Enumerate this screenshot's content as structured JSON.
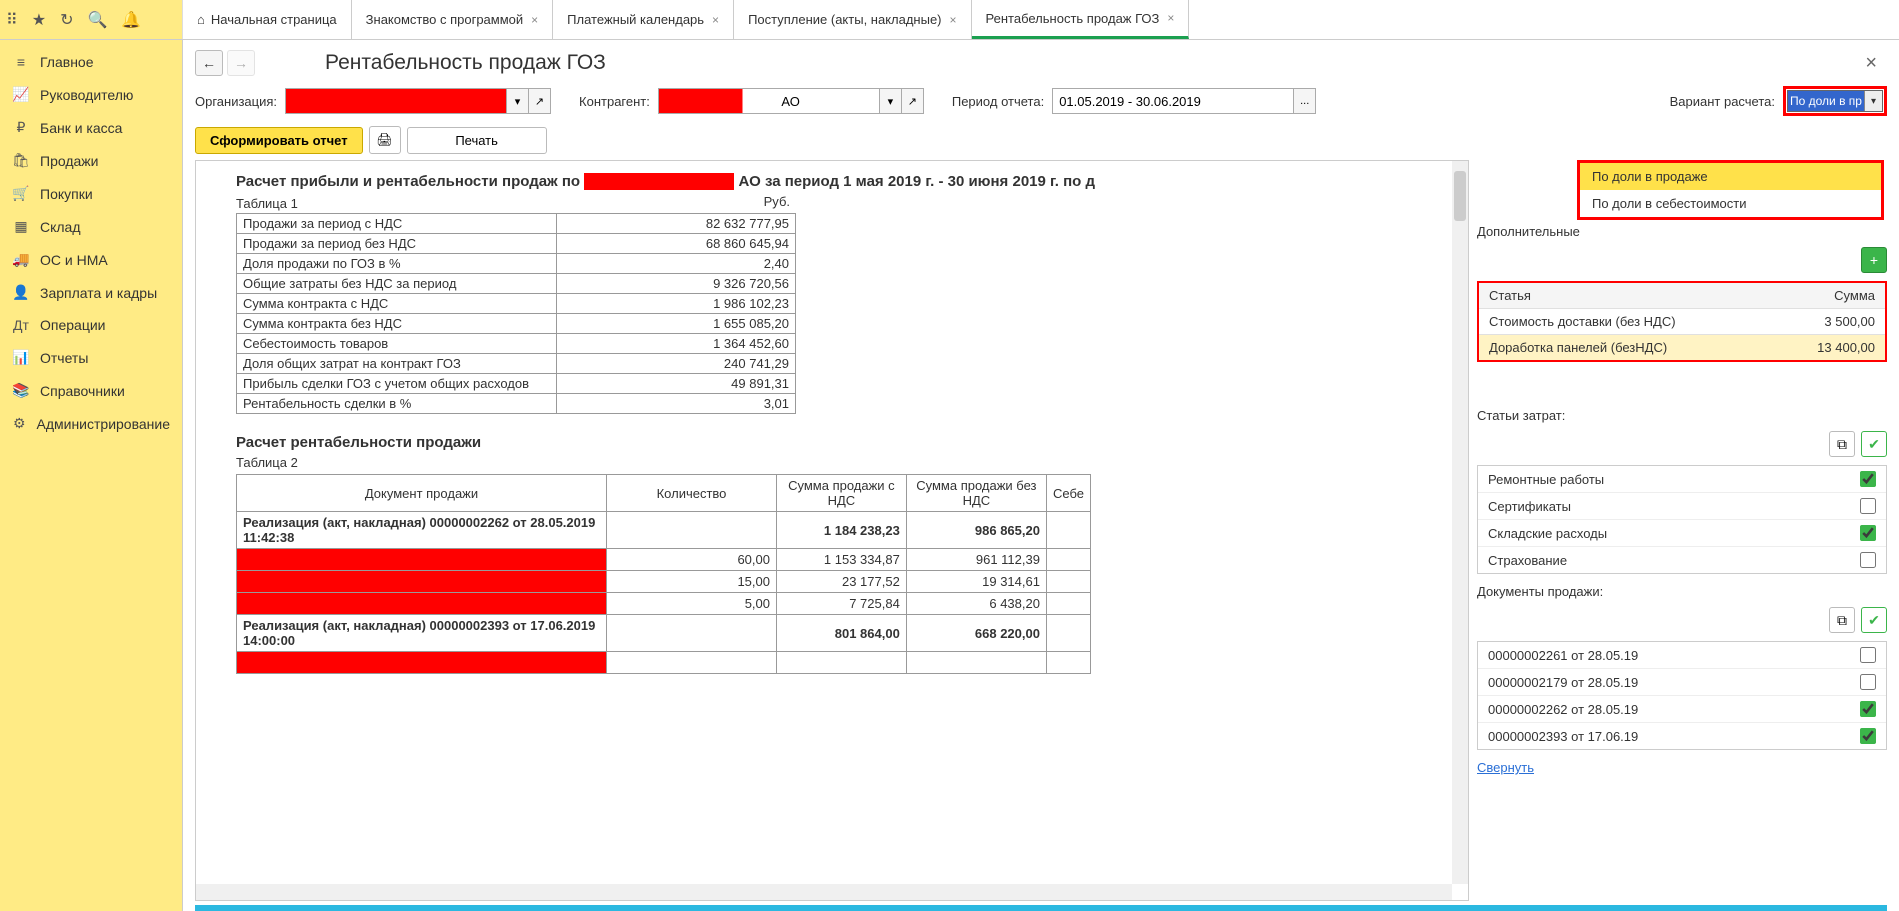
{
  "toolbar_icons": [
    "grid",
    "star",
    "history",
    "search",
    "bell"
  ],
  "tabs": [
    {
      "label": "Начальная страница",
      "home": true,
      "close": false
    },
    {
      "label": "Знакомство с программой",
      "close": true
    },
    {
      "label": "Платежный календарь",
      "close": true
    },
    {
      "label": "Поступление (акты, накладные)",
      "close": true
    },
    {
      "label": "Рентабельность продаж ГОЗ",
      "close": true,
      "active": true
    }
  ],
  "sidebar": [
    {
      "icon": "≡",
      "label": "Главное"
    },
    {
      "icon": "📈",
      "label": "Руководителю"
    },
    {
      "icon": "₽",
      "label": "Банк и касса"
    },
    {
      "icon": "🛍",
      "label": "Продажи"
    },
    {
      "icon": "🛒",
      "label": "Покупки"
    },
    {
      "icon": "▦",
      "label": "Склад"
    },
    {
      "icon": "🚚",
      "label": "ОС и НМА"
    },
    {
      "icon": "👤",
      "label": "Зарплата и кадры"
    },
    {
      "icon": "Дт",
      "label": "Операции"
    },
    {
      "icon": "📊",
      "label": "Отчеты"
    },
    {
      "icon": "📚",
      "label": "Справочники"
    },
    {
      "icon": "⚙",
      "label": "Администрирование"
    }
  ],
  "page_title": "Рентабельность продаж ГОЗ",
  "filters": {
    "org_label": "Организация:",
    "org_value": "████████",
    "contr_label": "Контрагент:",
    "contr_value": "████████ АО",
    "period_label": "Период отчета:",
    "period_value": "01.05.2019 - 30.06.2019",
    "variant_label": "Вариант расчета:",
    "variant_value": "По доли в про"
  },
  "variant_dropdown": [
    "По доли в продаже",
    "По доли в себестоимости"
  ],
  "actions": {
    "form": "Сформировать отчет",
    "print": "Печать"
  },
  "report": {
    "title_pre": "Расчет прибыли и рентабельности продаж по ",
    "title_post": "АО за период 1 мая 2019 г. - 30 июня 2019 г. по д",
    "t1_label": "Таблица 1",
    "rub": "Руб.",
    "t1": [
      {
        "name": "Продажи за период с НДС",
        "val": "82 632 777,95"
      },
      {
        "name": "Продажи за период без НДС",
        "val": "68 860 645,94"
      },
      {
        "name": "Доля продажи по ГОЗ в %",
        "val": "2,40"
      },
      {
        "name": "Общие затраты без НДС за период",
        "val": "9 326 720,56"
      },
      {
        "name": "Сумма контракта с НДС",
        "val": "1 986 102,23"
      },
      {
        "name": "Сумма контракта без НДС",
        "val": "1 655 085,20"
      },
      {
        "name": "Себестоимость товаров",
        "val": "1 364 452,60"
      },
      {
        "name": "Доля общих затрат на контракт ГОЗ",
        "val": "240 741,29"
      },
      {
        "name": "Прибыль сделки ГОЗ с учетом общих расходов",
        "val": "49 891,31"
      },
      {
        "name": "Рентабельность сделки в %",
        "val": "3,01"
      }
    ],
    "sec2_title": "Расчет рентабельности продажи",
    "t2_label": "Таблица 2",
    "t2_headers": [
      "Документ продажи",
      "Количество",
      "Сумма продажи с НДС",
      "Сумма продажи без НДС",
      "Себе"
    ],
    "t2_rows": [
      {
        "doc": "Реализация (акт, накладная) 00000002262 от 28.05.2019 11:42:38",
        "qty": "",
        "sum_vat": "1 184 238,23",
        "sum_novat": "986 865,20",
        "hdr": true
      },
      {
        "doc": "RED",
        "qty": "60,00",
        "sum_vat": "1 153 334,87",
        "sum_novat": "961 112,39"
      },
      {
        "doc": "RED",
        "qty": "15,00",
        "sum_vat": "23 177,52",
        "sum_novat": "19 314,61"
      },
      {
        "doc": "RED",
        "qty": "5,00",
        "sum_vat": "7 725,84",
        "sum_novat": "6 438,20"
      },
      {
        "doc": "Реализация (акт, накладная) 00000002393 от 17.06.2019 14:00:00",
        "qty": "",
        "sum_vat": "801 864,00",
        "sum_novat": "668 220,00",
        "hdr": true
      },
      {
        "doc": "RED",
        "qty": "",
        "sum_vat": "",
        "sum_novat": ""
      }
    ]
  },
  "right": {
    "extra_label": "Дополнительные",
    "art_col": "Статья",
    "sum_col": "Сумма",
    "art_rows": [
      {
        "name": "Стоимость доставки (без НДС)",
        "val": "3 500,00"
      },
      {
        "name": "Доработка панелей (безНДС)",
        "val": "13 400,00",
        "ylw": true
      }
    ],
    "costs_label": "Статьи затрат:",
    "costs": [
      {
        "name": "Ремонтные работы",
        "on": true
      },
      {
        "name": "Сертификаты",
        "on": false
      },
      {
        "name": "Складские расходы",
        "on": true
      },
      {
        "name": "Страхование",
        "on": false
      }
    ],
    "docs_label": "Документы продажи:",
    "docs": [
      {
        "name": "00000002261 от 28.05.19",
        "on": false
      },
      {
        "name": "00000002179 от 28.05.19",
        "on": false
      },
      {
        "name": "00000002262 от 28.05.19",
        "on": true
      },
      {
        "name": "00000002393 от 17.06.19",
        "on": true
      }
    ],
    "collapse": "Свернуть"
  }
}
